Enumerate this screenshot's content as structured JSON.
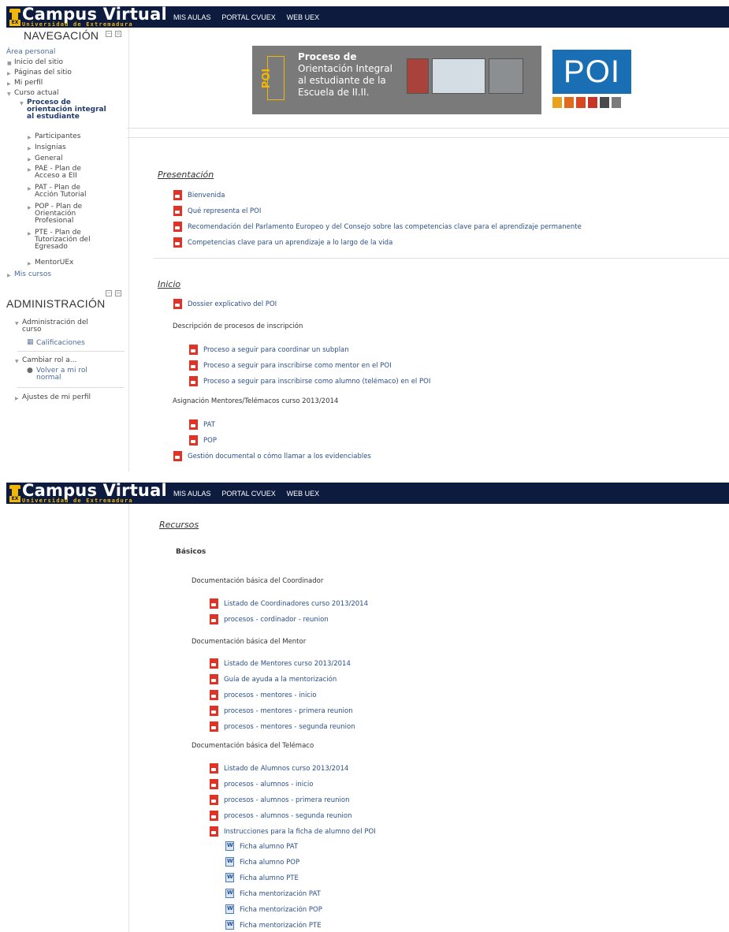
{
  "brand": {
    "title": "Campus Virtual",
    "subtitle": "Universidad de Extremadura",
    "badge": "EX"
  },
  "topnav": [
    "MIS AULAS",
    "PORTAL CVUEX",
    "WEB UEX"
  ],
  "navigation": {
    "title": "NAVEGACIÓN",
    "home": "Área personal",
    "items": [
      "Inicio del sitio",
      "Páginas del sitio",
      "Mi perfil",
      "Curso actual"
    ],
    "course": "Proceso de orientación integral al estudiante",
    "course_items": [
      "Participantes",
      "Insignias",
      "General",
      "PAE - Plan de Acceso a EII",
      "PAT - Plan de Acción Tutorial",
      "POP - Plan de Orientación Profesional",
      "PTE - Plan de Tutorización del Egresado",
      "MentorUEx"
    ],
    "my_courses": "Mis cursos"
  },
  "administration": {
    "title": "ADMINISTRACIÓN",
    "course_admin": "Administración del curso",
    "grades": "Calificaciones",
    "switch_role": "Cambiar rol a...",
    "return_role": "Volver a mi rol normal",
    "profile_settings": "Ajustes de mi perfil"
  },
  "banner": {
    "vertical": "POI",
    "lines": [
      "Proceso de",
      "Orientación Integral",
      "al estudiante de la",
      "Escuela de II.II."
    ],
    "logo": "POI",
    "logo_bar_colors": [
      "#e8a21b",
      "#e06a1d",
      "#d9471f",
      "#c63527",
      "#4a4a4a",
      "#7b7b7b"
    ]
  },
  "presentacion": {
    "title": "Presentación",
    "items": [
      "Bienvenida",
      "Qué representa el POI",
      "Recomendación del Parlamento Europeo y del Consejo sobre las competencias clave para el aprendizaje permanente",
      "Competencias clave para un aprendizaje a lo largo de la vida"
    ]
  },
  "inicio": {
    "title": "Inicio",
    "dossier": "Dossier explicativo del POI",
    "desc_label": "Descripción de procesos de inscripción",
    "desc_items": [
      "Proceso a seguir para coordinar un subplan",
      "Proceso a seguir para inscribirse como mentor en el POI",
      "Proceso a seguir para inscribirse como alumno (telémaco) en el POI"
    ],
    "asig_label": "Asignación Mentores/Telémacos curso 2013/2014",
    "asig_items": [
      "PAT",
      "POP"
    ],
    "gestion": "Gestión documental o cómo llamar a los evidenciables"
  },
  "recursos": {
    "title": "Recursos",
    "basicos": "Básicos",
    "coord_label": "Documentación básica del Coordinador",
    "coord_items": [
      "Listado de Coordinadores curso 2013/2014",
      "procesos - cordinador - reunion"
    ],
    "mentor_label": "Documentación básica del Mentor",
    "mentor_items": [
      "Listado de Mentores curso 2013/2014",
      "Guía de ayuda a la mentorización",
      "procesos - mentores - inicio",
      "procesos - mentores - primera reunion",
      "procesos - mentores - segunda reunion"
    ],
    "tele_label": "Documentación básica del Telémaco",
    "tele_items": [
      "Listado de Alumnos curso 2013/2014",
      "procesos - alumnos - inicio",
      "procesos - alumnos - primera reunion",
      "procesos - alumnos - segunda reunion",
      "Instrucciones para la ficha de alumno del POI"
    ],
    "fichas": [
      "Ficha alumno PAT",
      "Ficha alumno POP",
      "Ficha alumno PTE",
      "Ficha mentorización PAT",
      "Ficha mentorización POP",
      "Ficha mentorización PTE"
    ]
  }
}
